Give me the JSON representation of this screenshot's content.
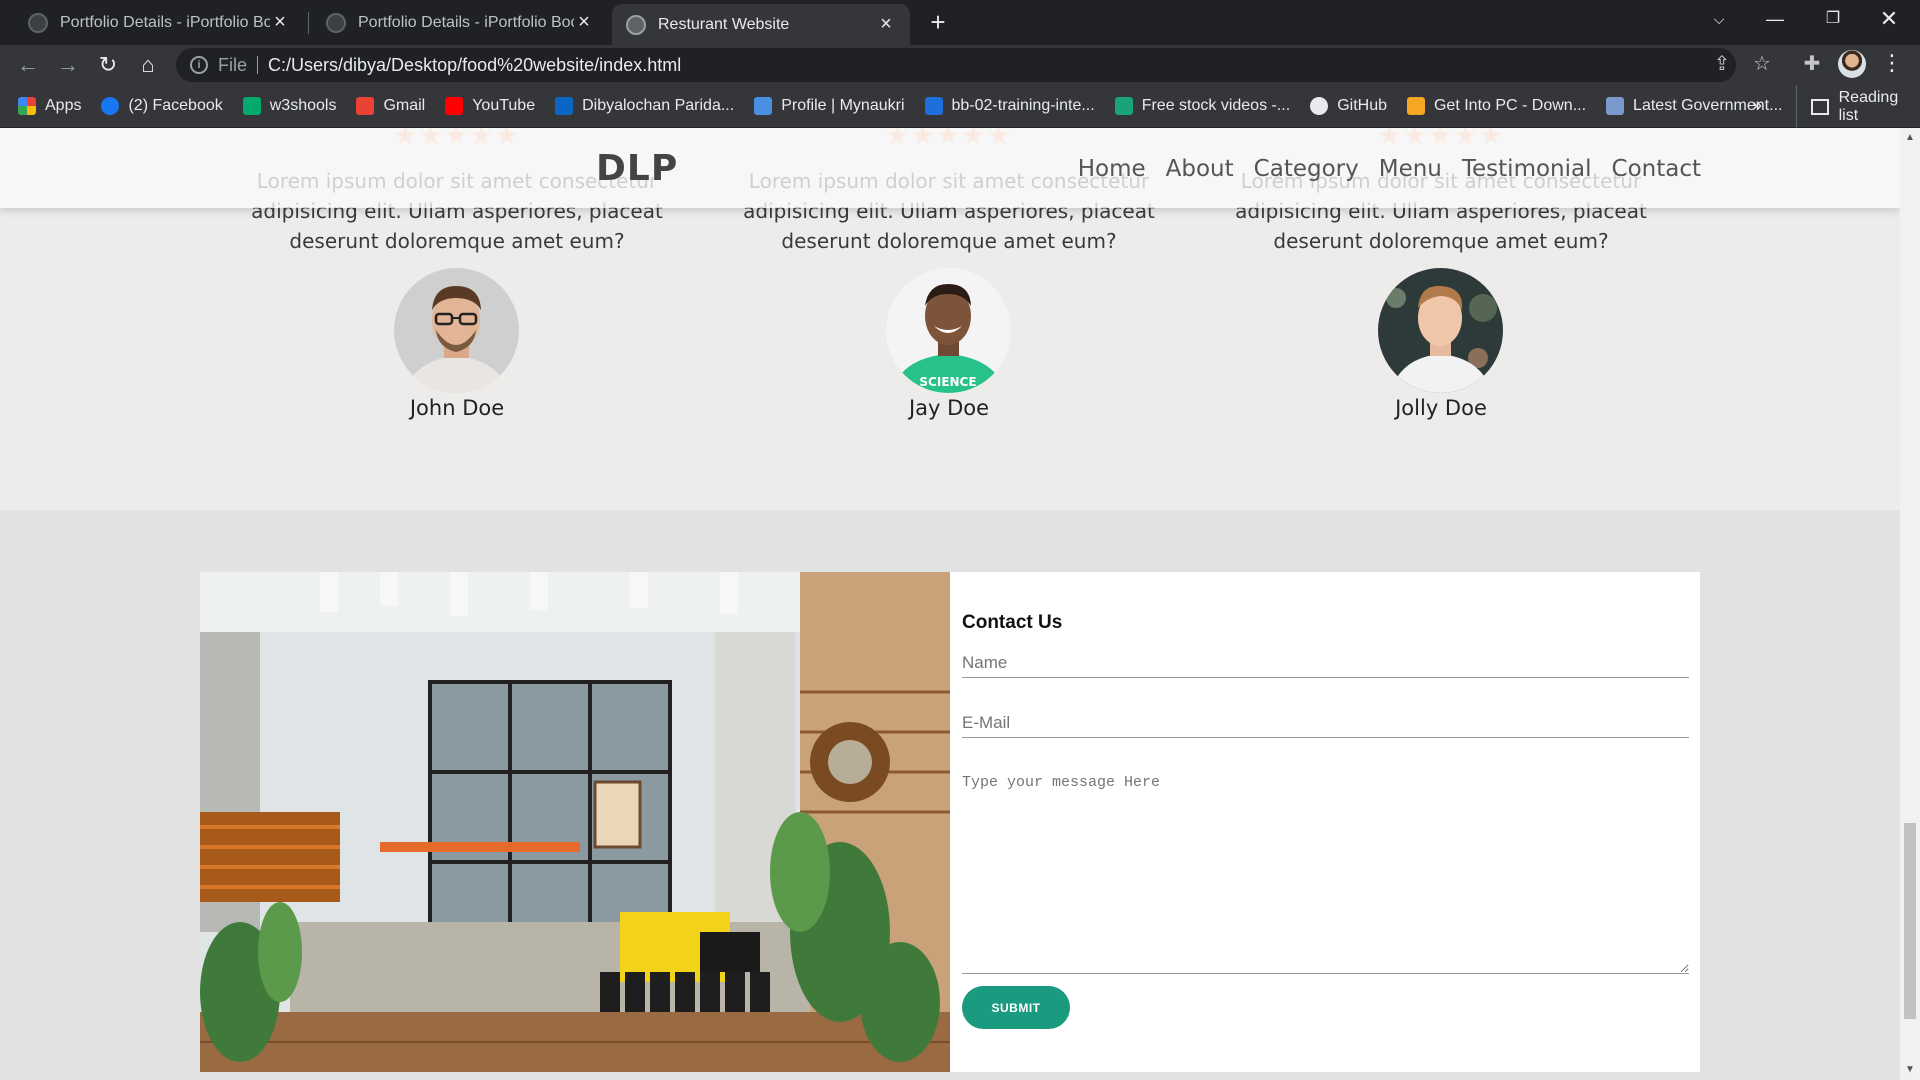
{
  "browser": {
    "tabs": [
      {
        "title": "Portfolio Details - iPortfolio Boots",
        "active": false
      },
      {
        "title": "Portfolio Details - iPortfolio Boots",
        "active": false
      },
      {
        "title": "Resturant Website",
        "active": true
      }
    ],
    "address": {
      "scheme": "File",
      "url": "C:/Users/dibya/Desktop/food%20website/index.html"
    },
    "bookmarks": [
      {
        "label": "Apps",
        "color": "#ea4335"
      },
      {
        "label": "(2) Facebook",
        "color": "#1877f2"
      },
      {
        "label": "w3shools",
        "color": "#04aa6d"
      },
      {
        "label": "Gmail",
        "color": "#ea4335"
      },
      {
        "label": "YouTube",
        "color": "#ff0000"
      },
      {
        "label": "Dibyalochan Parida...",
        "color": "#0a66c2"
      },
      {
        "label": "Profile | Mynaukri",
        "color": "#4a90e2"
      },
      {
        "label": "bb-02-training-inte...",
        "color": "#1e6fd9"
      },
      {
        "label": "Free stock videos -...",
        "color": "#1aa377"
      },
      {
        "label": "GitHub",
        "color": "#e8eaed"
      },
      {
        "label": "Get Into PC - Down...",
        "color": "#f5a623"
      },
      {
        "label": "Latest Government...",
        "color": "#7b9acc"
      }
    ],
    "more_bookmarks": "»",
    "reading_list": "Reading list"
  },
  "site": {
    "logo": "DLP",
    "nav": [
      "Home",
      "About",
      "Category",
      "Menu",
      "Testimonial",
      "Contact"
    ]
  },
  "testimonials": [
    {
      "text": "Lorem ipsum dolor sit amet consectetur adipisicing elit. Ullam asperiores, placeat deserunt doloremque amet eum?",
      "name": "John Doe",
      "stars": 5
    },
    {
      "text": "Lorem ipsum dolor sit amet consectetur adipisicing elit. Ullam asperiores, placeat deserunt doloremque amet eum?",
      "name": "Jay Doe",
      "stars": 5
    },
    {
      "text": "Lorem ipsum dolor sit amet consectetur adipisicing elit. Ullam asperiores, placeat deserunt doloremque amet eum?",
      "name": "Jolly Doe",
      "stars": 5
    }
  ],
  "contact": {
    "title": "Contact Us",
    "name_placeholder": "Name",
    "email_placeholder": "E-Mail",
    "message_placeholder": "Type your message Here",
    "submit_label": "SUBMIT"
  },
  "colors": {
    "accent": "#1a9a7e",
    "star": "#f7b489"
  }
}
